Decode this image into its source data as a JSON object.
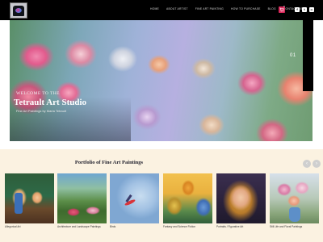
{
  "header": {
    "nav": [
      "HOME",
      "ABOUT ARTIST",
      "FINE ART PAINTING",
      "HOW TO PURCHASE",
      "BLOG",
      "CONTACT US"
    ],
    "cart_count": "0",
    "social": [
      "f",
      "t",
      "in"
    ],
    "colors": {
      "bar": "#000000",
      "cart": "#d8285a"
    }
  },
  "hero": {
    "welcome": "WELCOME TO THE",
    "title": "Tetrault Art Studio",
    "subtitle": "Fine Art Paintings by Maria Tetrault",
    "counter": "01"
  },
  "portfolio": {
    "title": "Portfolio of Fine Art Paintings",
    "prev_icon": "chevron-left-icon",
    "next_icon": "chevron-right-icon",
    "items": [
      {
        "label": "Allegorical Art"
      },
      {
        "label": "Architecture and Landscape Paintings"
      },
      {
        "label": "Birds"
      },
      {
        "label": "Fantasy and Science Fiction"
      },
      {
        "label": "Portraits / Figurative Art"
      },
      {
        "label": "Still Life and Floral Paintings"
      }
    ],
    "colors": {
      "background": "#fbf2e1"
    }
  }
}
